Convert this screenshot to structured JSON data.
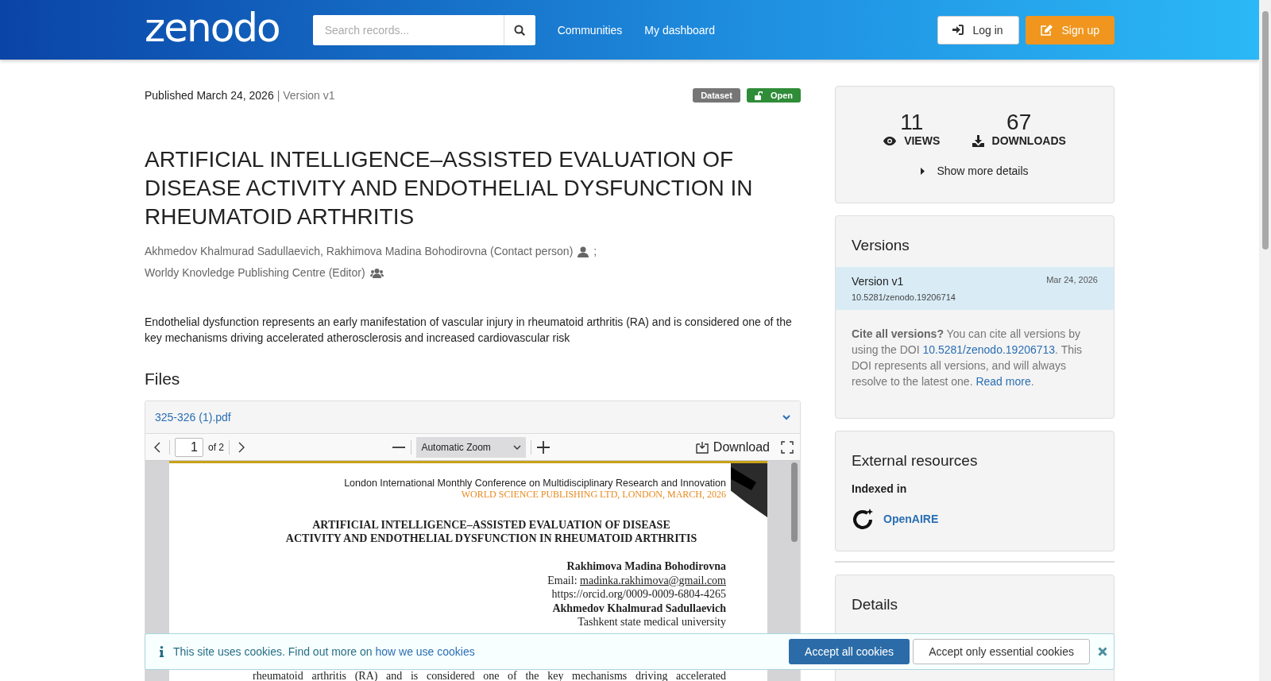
{
  "header": {
    "logo": "zenodo",
    "search": {
      "placeholder": "Search records..."
    },
    "nav": [
      "Communities",
      "My dashboard"
    ],
    "login": "Log in",
    "signup": "Sign up"
  },
  "record": {
    "published": "Published March 24, 2026",
    "version": "| Version v1",
    "badges": [
      {
        "label": "Dataset",
        "kind": "type"
      },
      {
        "label": "Open",
        "kind": "access"
      }
    ],
    "title": "ARTIFICIAL INTELLIGENCE–ASSISTED EVALUATION OF DISEASE ACTIVITY AND ENDOTHELIAL DYSFUNCTION IN RHEUMATOID ARTHRITIS",
    "creators": [
      {
        "text": "Akhmedov Khalmurad Sadullaevich, Rakhimova Madina Bohodirovna (Contact person)",
        "kind": "person",
        "trailing": ";"
      },
      {
        "text": "Worldy Knovledge Publishing Centre (Editor)",
        "kind": "group"
      }
    ],
    "abstract": "Endothelial dysfunction represents an early manifestation of vascular injury in rheumatoid arthritis (RA) and is considered one of the key mechanisms driving accelerated atherosclerosis and increased cardiovascular risk"
  },
  "files": {
    "heading": "Files",
    "filename": "325-326 (1).pdf",
    "viewer": {
      "page": "1",
      "page_count": "of 2",
      "zoom": "Automatic Zoom",
      "download": "Download",
      "document": {
        "conference": "London International Monthly Conference on Multidisciplinary Research and Innovation",
        "publisher": "WORLD SCIENCE PUBLISHING LTD, LONDON,  MARCH, 2026",
        "title_lines": [
          "ARTIFICIAL INTELLIGENCE–ASSISTED EVALUATION OF DISEASE",
          "ACTIVITY AND ENDOTHELIAL DYSFUNCTION IN RHEUMATOID ARTHRITIS"
        ],
        "author_lines": [
          {
            "kind": "name",
            "text": "Rakhimova Madina Bohodirovna"
          },
          {
            "kind": "email",
            "label": "Email:",
            "link": "madinka.rakhimova@gmail.com"
          },
          {
            "kind": "text",
            "text": "https://orcid.org/0009-0009-6804-4265"
          },
          {
            "kind": "name",
            "text": "Akhmedov Khalmurad Sadullaevich"
          },
          {
            "kind": "text",
            "text": "Tashkent state medical university"
          }
        ],
        "body_line": "rheumatoid arthritis (RA) and is considered one of the key mechanisms driving accelerated"
      }
    }
  },
  "sidebar": {
    "stats": [
      {
        "value": "11",
        "label": "VIEWS",
        "kind": "views"
      },
      {
        "value": "67",
        "label": "DOWNLOADS",
        "kind": "downloads"
      }
    ],
    "more": "Show more details",
    "versions": {
      "heading": "Versions",
      "items": [
        {
          "label": "Version v1",
          "date": "Mar 24, 2026",
          "doi": "10.5281/zenodo.19206714",
          "selected": true
        }
      ],
      "cite": {
        "lead": "**Cite all versions?** You can cite all versions by using the DOI ",
        "doi_link": "10.5281/zenodo.19206713",
        "middle": ". This DOI represents all versions, and will always resolve to the latest one. ",
        "read_more": "Read more",
        "end": "."
      }
    },
    "external": {
      "heading": "External resources",
      "subheading": "Indexed in",
      "items": [
        {
          "name": "OpenAIRE"
        }
      ]
    },
    "details": {
      "heading": "Details"
    }
  },
  "cookie": {
    "text": "This site uses cookies. Find out more on ",
    "link": "how we use cookies",
    "accept_all": "Accept all cookies",
    "accept_essential": "Accept only essential cookies"
  }
}
